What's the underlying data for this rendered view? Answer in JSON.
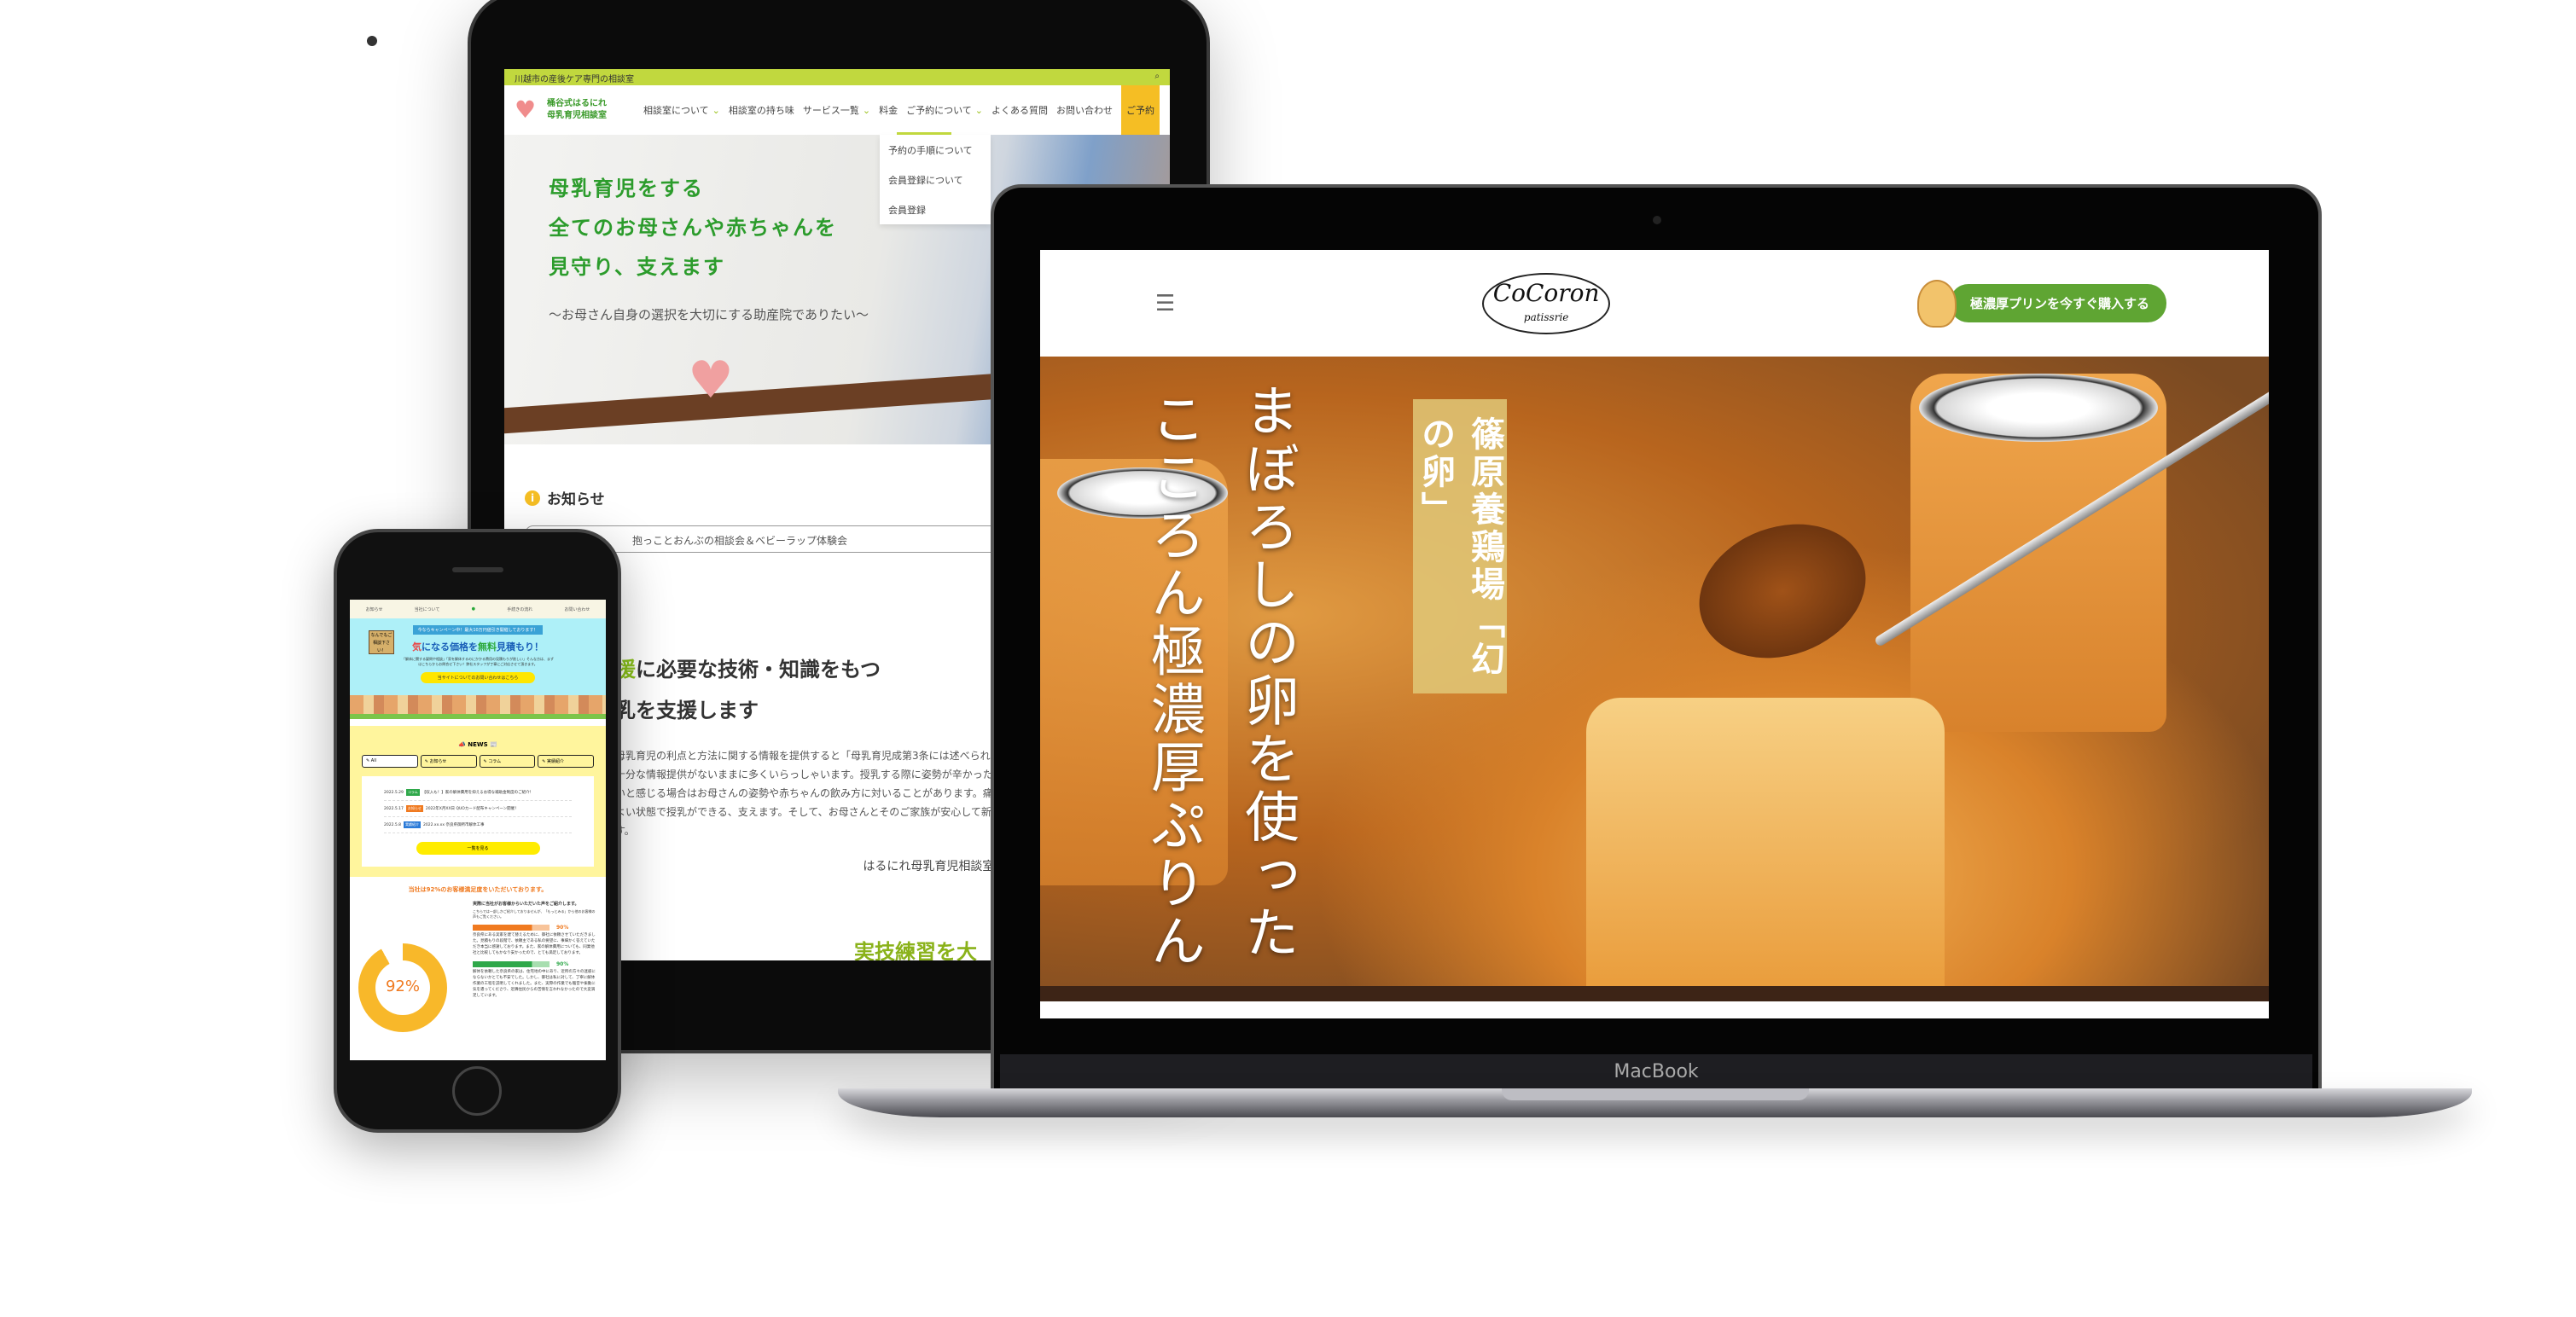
{
  "tablet": {
    "topbar": "川越市の産後ケア専門の相談室",
    "logo": [
      "桶谷式はるにれ",
      "母乳育児相談室"
    ],
    "nav": [
      "相談室について",
      "相談室の持ち味",
      "サービス一覧",
      "料金",
      "ご予約について",
      "よくある質問",
      "お問い合わせ",
      "ご予約"
    ],
    "dropdown": [
      "予約の手順について",
      "会員登録について",
      "会員登録"
    ],
    "hero": [
      "母乳育児をする",
      "全てのお母さんや赤ちゃんを",
      "見守り、支えます"
    ],
    "hero_sub": "〜お母さん自身の選択を大切にする助産院でありたい〜",
    "news_title": "お知らせ",
    "news_item": "抱っことおんぶの相談会＆ベビーラップ体験会",
    "mid_heading_green": "援",
    "mid_heading": "に必要な技術・知識をもつ",
    "mid_heading2": "乳を支援します",
    "mid_body": "母乳育児の利点と方法に関する情報を提供すると「母乳育児成第3条には述べられていますが、十分な情報提供がないままに多くいらっしゃいます。授乳する際に姿勢が辛かったり赤ちゃえないと感じる場合はお母さんの姿勢や赤ちゃんの飲み方に対いることがあります。痛みがなく心地よい状態で授乳ができる、支えます。そして、お母さんとそのご家族が安心して新生活ートします。",
    "more_link": "はるにれ母乳育児相談室について",
    "section_partial": "実技練習を大"
  },
  "macbook": {
    "label": "MacBook",
    "logo": "CoCoron",
    "logo_sub": "patissrie",
    "buy_button": "極濃厚プリンを今すぐ購入する",
    "box_text": "篠原養鶏場「幻の卵」",
    "line1": "まぼろしの卵を使った",
    "line2": "こころん極濃厚ぷりん"
  },
  "phone": {
    "nav": [
      "お知らせ",
      "当社について",
      "",
      "手続きの流れ",
      "お問い合わせ"
    ],
    "campaign": "今ならキャンペーン中！最大10万円値引き開催しております！",
    "sign": "なんでもご相談下さい！",
    "title_red": "気",
    "title_a": "になる価格を",
    "title_green": "無料",
    "title_b": "見積もり！",
    "hero_text": "「解体に関する疑問や相談」「家を解体するのにかかる費用の見積もりが欲しい」そんな方は、まずはこちらからお問合せ下さい！弊社スタッフが丁寧にご対応させて頂きます。",
    "hero_cta": "当サイトについてのお問い合わせはこちら",
    "news_heading": "NEWS",
    "tabs": [
      "All",
      "お知らせ",
      "コラム",
      "実績紹介"
    ],
    "news": [
      {
        "date": "2022.5.29",
        "tag": "コラム",
        "color": "#2fa84a",
        "text": "【収入も！】家の解体費用を抑えるお得な補助金制度のご紹介！"
      },
      {
        "date": "2022.5.17",
        "tag": "お知らせ",
        "color": "#f07a20",
        "text": "2022年X月XX日 QUOカード配布キャンペーン開催！"
      },
      {
        "date": "2022.5.8",
        "tag": "実績紹介",
        "color": "#2a7ad8",
        "text": "2022.xx.xx 奈良県御所市解体工事"
      }
    ],
    "more_button": "一覧を見る",
    "satisfaction": "当社は92%のお客様満足度をいただいております。",
    "donut_value": 92,
    "donut_label": "92%",
    "voices_title": "実際に当社がお客様からいただいた声をご紹介します。",
    "voices_sub": "こちらでは一部しかご紹介しておりませんが、「もっとみる」から他のお客様の声もご覧ください。",
    "reviews": [
      {
        "score": 90,
        "label": "90%",
        "color": "#f07a20",
        "light": "#f8c49a",
        "text": "奈良県にある実家を建て替えるために、御社に依頼させていただきました。見積もりの段階で、依頼主である私の要望に、事細かく答えていただき本当に感謝しております。また、家の解体費用についても、同業他社と比較してもかなり安かったので、とても満足しております。"
      },
      {
        "score": 90,
        "label": "90%",
        "color": "#2fa84a",
        "light": "#a8deb0",
        "text": "解体を依頼した奈良県の家は、住宅地の中にあり、近所の方々の迷惑にならないかとても不安でした。しかし、御社は私に対して、丁寧に解体作業の工程を説明してくれました。また、実際の作業でも騒音や振動に気を遣ってくださり、近隣住民からの苦情を言われなかったので大変満足しています。"
      }
    ]
  }
}
